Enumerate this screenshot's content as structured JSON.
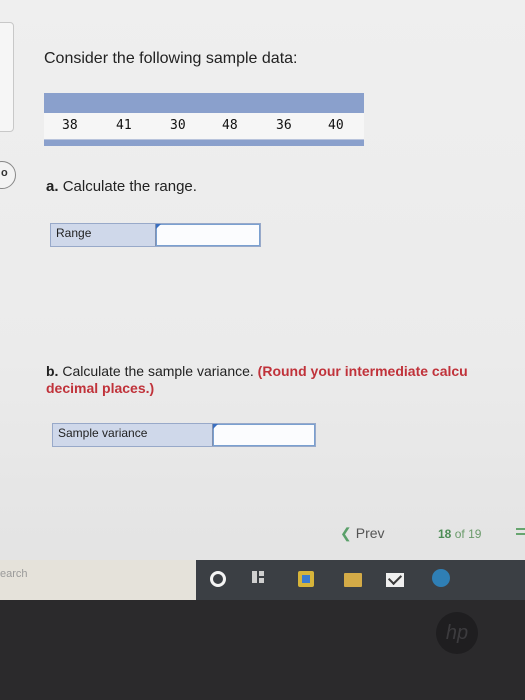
{
  "question": {
    "intro": "Consider the following sample data:",
    "values": [
      "38",
      "41",
      "30",
      "48",
      "36",
      "40"
    ],
    "part_a": {
      "letter": "a.",
      "text": "Calculate the range.",
      "field_label": "Range",
      "field_value": ""
    },
    "part_b": {
      "letter": "b.",
      "text": "Calculate the sample variance.",
      "note": "(Round your intermediate calcu",
      "note_cont": "decimal places.)",
      "field_label": "Sample variance",
      "field_value": ""
    }
  },
  "left_circle_digit": "o",
  "navigation": {
    "prev_label": "Prev",
    "current_page": "18",
    "of_label": "of",
    "total_pages": "19"
  },
  "taskbar": {
    "search_text": "earch"
  },
  "laptop_logo": "hp",
  "colors": {
    "table_header": "#8aa0cc",
    "emphasis_red": "#c0323a",
    "nav_green": "#4d8d55",
    "taskbar_dark": "#3b3f44"
  }
}
